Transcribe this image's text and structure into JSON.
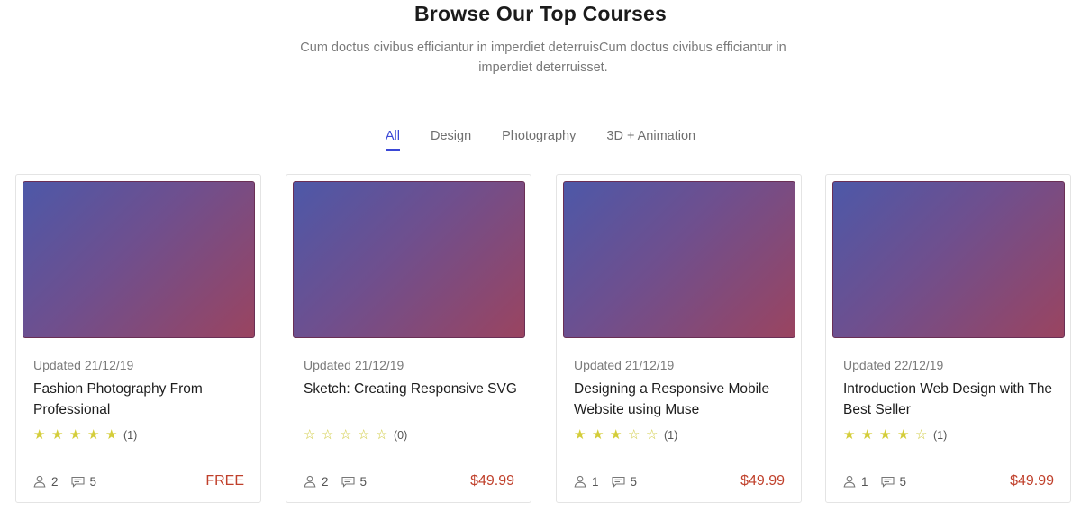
{
  "section": {
    "title": "Browse Our Top Courses",
    "subtitle": "Cum doctus civibus efficiantur in imperdiet deterruisCum doctus civibus efficiantur in imperdiet deterruisset."
  },
  "tabs": [
    {
      "label": "All",
      "active": true
    },
    {
      "label": "Design",
      "active": false
    },
    {
      "label": "Photography",
      "active": false
    },
    {
      "label": "3D + Animation",
      "active": false
    }
  ],
  "courses": [
    {
      "updated": "Updated 21/12/19",
      "title": "Fashion Photography From Professional",
      "rating": 5,
      "rating_count": "(1)",
      "students": "2",
      "comments": "5",
      "price": "FREE"
    },
    {
      "updated": "Updated 21/12/19",
      "title": "Sketch: Creating Responsive SVG",
      "rating": 0,
      "rating_count": "(0)",
      "students": "2",
      "comments": "5",
      "price": "$49.99"
    },
    {
      "updated": "Updated 21/12/19",
      "title": "Designing a Responsive Mobile Website using Muse",
      "rating": 3,
      "rating_count": "(1)",
      "students": "1",
      "comments": "5",
      "price": "$49.99"
    },
    {
      "updated": "Updated 22/12/19",
      "title": "Introduction Web Design with The Best Seller",
      "rating": 4,
      "rating_count": "(1)",
      "students": "1",
      "comments": "5",
      "price": "$49.99"
    }
  ],
  "icons": {
    "students": "user-icon",
    "comments": "comment-icon",
    "star": "star-icon"
  },
  "colors": {
    "accent": "#3a48d6",
    "price": "#c0402b",
    "star": "#d4cd3a"
  }
}
